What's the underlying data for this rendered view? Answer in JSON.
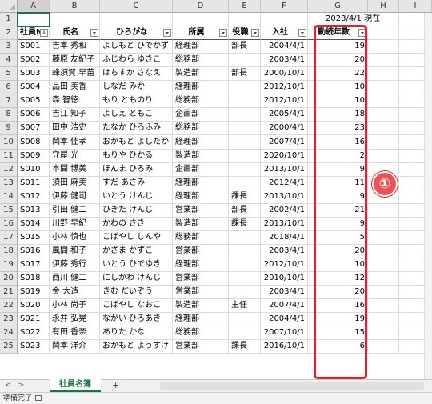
{
  "columns": [
    "A",
    "B",
    "C",
    "D",
    "E",
    "F",
    "G",
    "H",
    "I"
  ],
  "selected_col": "A",
  "row1": {
    "a1": "",
    "date_note": "2023/4/1 現在"
  },
  "headers": {
    "id": "社員No",
    "name": "氏名",
    "kana": "ひらがな",
    "dept": "所属",
    "role": "役職",
    "join": "入社",
    "years": "勤続年数"
  },
  "rows": [
    {
      "n": "3",
      "id": "S001",
      "name": "吉本 秀和",
      "kana": "よしもと ひでかず",
      "dept": "経理部",
      "role": "部長",
      "join": "2004/4/1",
      "years": "19"
    },
    {
      "n": "4",
      "id": "S002",
      "name": "藤原 友紀子",
      "kana": "ふじわら ゆきこ",
      "dept": "総務部",
      "role": "",
      "join": "2003/4/1",
      "years": "20"
    },
    {
      "n": "5",
      "id": "S003",
      "name": "蜂須賀 早苗",
      "kana": "はちすか さなえ",
      "dept": "製造部",
      "role": "部長",
      "join": "2000/10/1",
      "years": "22"
    },
    {
      "n": "6",
      "id": "S004",
      "name": "品田 美香",
      "kana": "しなだ みか",
      "dept": "経理部",
      "role": "",
      "join": "2012/10/1",
      "years": "10"
    },
    {
      "n": "7",
      "id": "S005",
      "name": "森 智徳",
      "kana": "もり とものり",
      "dept": "総務部",
      "role": "",
      "join": "2012/10/1",
      "years": "10"
    },
    {
      "n": "8",
      "id": "S006",
      "name": "吉江 知子",
      "kana": "よしえ ともこ",
      "dept": "企画部",
      "role": "",
      "join": "2005/4/1",
      "years": "18"
    },
    {
      "n": "9",
      "id": "S007",
      "name": "田中 浩史",
      "kana": "たなか ひろふみ",
      "dept": "総務部",
      "role": "",
      "join": "2000/4/1",
      "years": "23"
    },
    {
      "n": "10",
      "id": "S008",
      "name": "岡本 佳孝",
      "kana": "おかもと よしたか",
      "dept": "経理部",
      "role": "",
      "join": "2007/4/1",
      "years": "16"
    },
    {
      "n": "11",
      "id": "S009",
      "name": "守屋 光",
      "kana": "もりや ひかる",
      "dept": "製造部",
      "role": "",
      "join": "2020/10/1",
      "years": "2"
    },
    {
      "n": "12",
      "id": "S010",
      "name": "本間 博美",
      "kana": "ほんま ひろみ",
      "dept": "企画部",
      "role": "",
      "join": "2013/10/1",
      "years": "9"
    },
    {
      "n": "13",
      "id": "S011",
      "name": "須田 麻美",
      "kana": "すだ あさみ",
      "dept": "経理部",
      "role": "",
      "join": "2012/4/1",
      "years": "11"
    },
    {
      "n": "14",
      "id": "S012",
      "name": "伊藤 健司",
      "kana": "いとう けんじ",
      "dept": "経理部",
      "role": "課長",
      "join": "2013/10/1",
      "years": "9"
    },
    {
      "n": "15",
      "id": "S013",
      "name": "引田 健二",
      "kana": "ひきた けんじ",
      "dept": "営業部",
      "role": "部長",
      "join": "2002/4/1",
      "years": "21"
    },
    {
      "n": "16",
      "id": "S014",
      "name": "川野 早紀",
      "kana": "かわの さき",
      "dept": "製造部",
      "role": "課長",
      "join": "2013/10/1",
      "years": "9"
    },
    {
      "n": "17",
      "id": "S015",
      "name": "小林 慎也",
      "kana": "こばやし しんや",
      "dept": "総務部",
      "role": "",
      "join": "2018/4/1",
      "years": "5"
    },
    {
      "n": "18",
      "id": "S016",
      "name": "風間 和子",
      "kana": "かざま かずこ",
      "dept": "営業部",
      "role": "",
      "join": "2003/4/1",
      "years": "20"
    },
    {
      "n": "19",
      "id": "S017",
      "name": "伊藤 秀行",
      "kana": "いとう ひでゆき",
      "dept": "経理部",
      "role": "",
      "join": "2012/10/1",
      "years": "10"
    },
    {
      "n": "20",
      "id": "S018",
      "name": "西川 健二",
      "kana": "にしかわ けんじ",
      "dept": "営業部",
      "role": "",
      "join": "2010/10/1",
      "years": "12"
    },
    {
      "n": "21",
      "id": "S019",
      "name": "金 大造",
      "kana": "きむ だいぞう",
      "dept": "営業部",
      "role": "",
      "join": "2003/4/1",
      "years": "20"
    },
    {
      "n": "22",
      "id": "S020",
      "name": "小林 尚子",
      "kana": "こばやし なおこ",
      "dept": "製造部",
      "role": "主任",
      "join": "2007/4/1",
      "years": "16"
    },
    {
      "n": "23",
      "id": "S021",
      "name": "永井 弘晃",
      "kana": "ながい ひろあき",
      "dept": "経理部",
      "role": "",
      "join": "2004/4/1",
      "years": "19"
    },
    {
      "n": "24",
      "id": "S022",
      "name": "有田 香奈",
      "kana": "ありた かな",
      "dept": "総務部",
      "role": "",
      "join": "2007/10/1",
      "years": "15"
    },
    {
      "n": "25",
      "id": "S023",
      "name": "岡本 洋介",
      "kana": "おかもと ようすけ",
      "dept": "営業部",
      "role": "課長",
      "join": "2016/10/1",
      "years": "6"
    }
  ],
  "callout": "①",
  "sheet_tab": "社員名簿",
  "add_sheet": "+",
  "nav_prev": "<",
  "nav_next": ">",
  "status": "準備完了",
  "colors": {
    "accent": "#217346",
    "highlight": "#e3202b"
  }
}
